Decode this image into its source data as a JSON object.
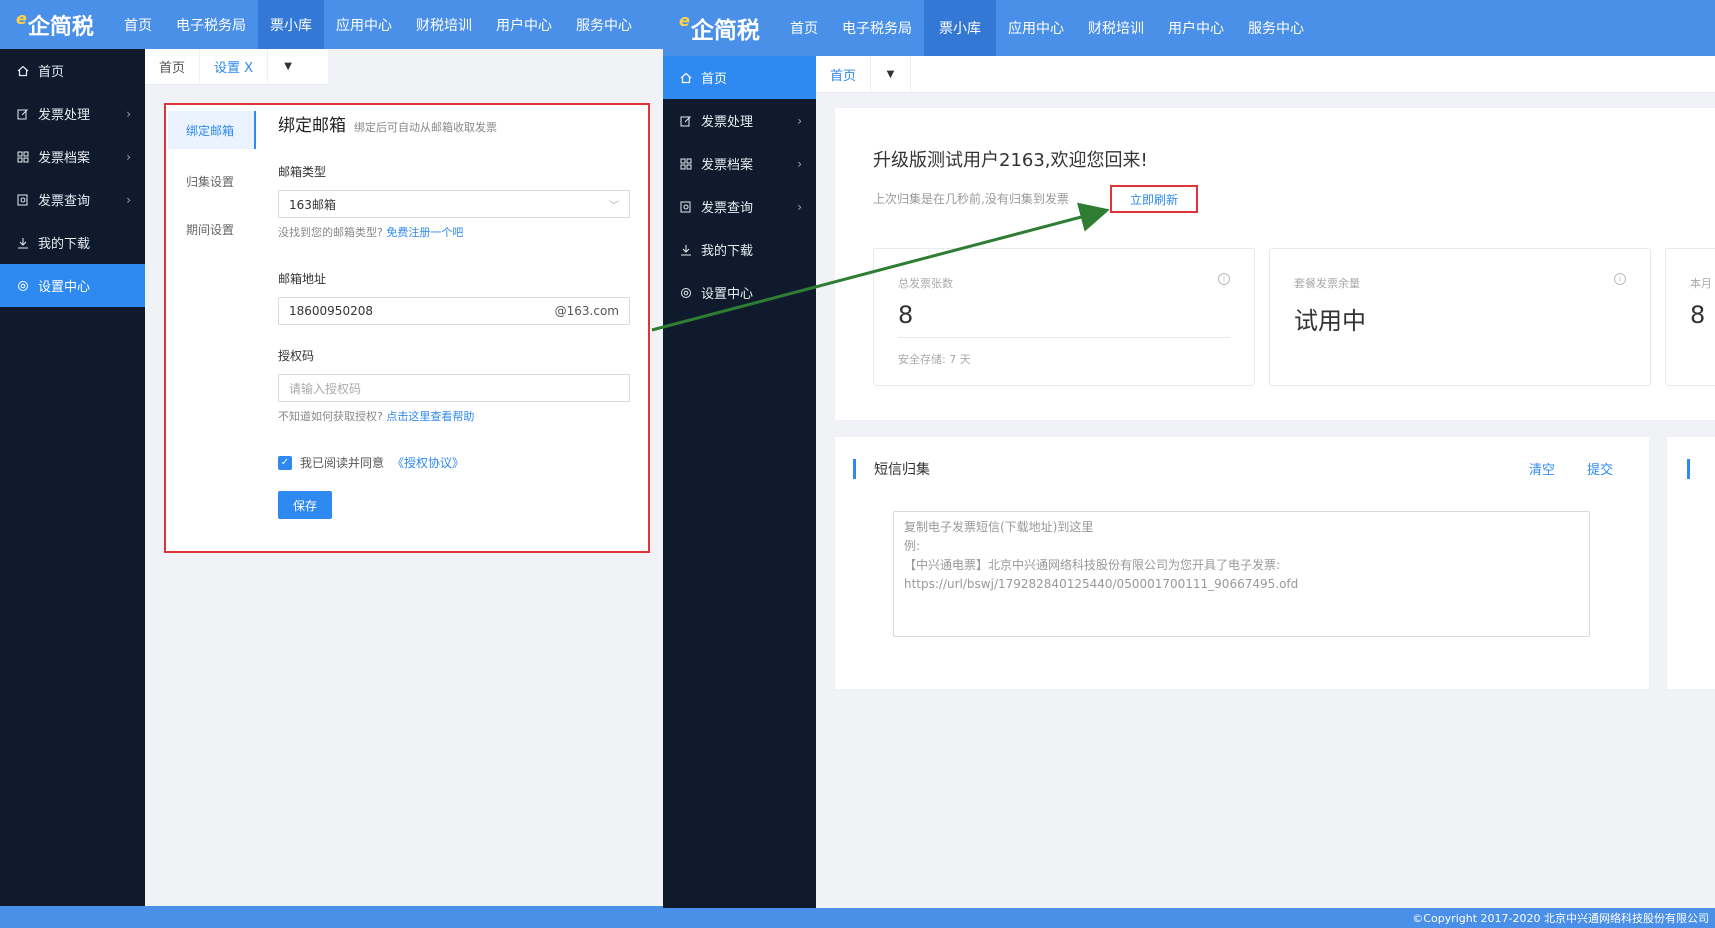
{
  "nav": {
    "logo_text": "企简税",
    "items": [
      "首页",
      "电子税务局",
      "票小库",
      "应用中心",
      "财税培训",
      "用户中心",
      "服务中心"
    ],
    "active": 2
  },
  "sidebar": {
    "items": [
      {
        "label": "首页",
        "icon": "home-icon",
        "has_arrow": false
      },
      {
        "label": "发票处理",
        "icon": "edit-icon",
        "has_arrow": true
      },
      {
        "label": "发票档案",
        "icon": "grid-icon",
        "has_arrow": true
      },
      {
        "label": "发票查询",
        "icon": "search-doc-icon",
        "has_arrow": true
      },
      {
        "label": "我的下载",
        "icon": "download-icon",
        "has_arrow": false
      },
      {
        "label": "设置中心",
        "icon": "gear-icon",
        "has_arrow": false
      }
    ]
  },
  "left": {
    "tabs": {
      "home": "首页",
      "settings": "设置 X"
    },
    "subnav": [
      "绑定邮箱",
      "归集设置",
      "期间设置"
    ],
    "form": {
      "title": "绑定邮箱",
      "subtitle": "绑定后可自动从邮箱收取发票",
      "mail_type_label": "邮箱类型",
      "mail_type_value": "163邮箱",
      "mail_type_hint": "没找到您的邮箱类型?",
      "mail_type_link": "免费注册一个吧",
      "address_label": "邮箱地址",
      "address_value": "18600950208",
      "address_suffix": "@163.com",
      "auth_label": "授权码",
      "auth_placeholder": "请输入授权码",
      "auth_hint": "不知道如何获取授权?",
      "auth_link": "点击这里查看帮助",
      "agree_text": "我已阅读并同意",
      "agree_link": "《授权协议》",
      "save_label": "保存"
    }
  },
  "right": {
    "tab_home": "首页",
    "welcome": "升级版测试用户2163,欢迎您回来!",
    "last_collect": "上次归集是在几秒前,没有归集到发票",
    "refresh": "立即刷新",
    "stats": [
      {
        "label": "总发票张数",
        "value": "8",
        "sub": "安全存储: 7 天"
      },
      {
        "label": "套餐发票余量",
        "value": "试用中",
        "sub": ""
      },
      {
        "label": "本月",
        "value": "8",
        "sub": ""
      }
    ],
    "sms": {
      "title": "短信归集",
      "clear": "清空",
      "submit": "提交",
      "placeholder_lines": [
        "复制电子发票短信(下载地址)到这里",
        "例:",
        "【中兴通电票】北京中兴通网络科技股份有限公司为您开具了电子发票:",
        "https://url/bswj/179282840125440/050001700111_90667495.ofd"
      ]
    },
    "copyright": "©Copyright 2017-2020 北京中兴通网络科技股份有限公司"
  },
  "colors": {
    "topbar": "#4a90e8",
    "sidebar": "#0f1b2d",
    "accent": "#2e89f0",
    "highlight_border": "#e0343a",
    "arrow": "#2e7d32"
  }
}
